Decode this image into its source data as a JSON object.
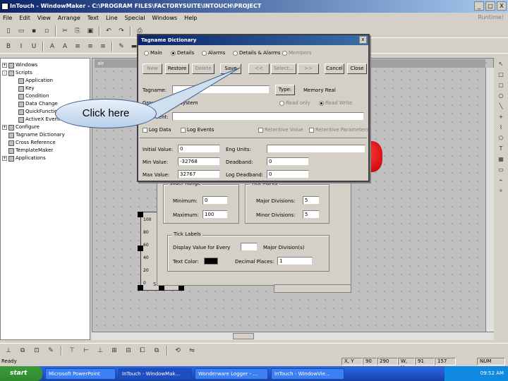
{
  "window": {
    "title": "InTouch - WindowMaker - C:\\PROGRAM FILES\\FACTORYSUITE\\INTOUCH\\PROJECT",
    "runtime_label": "Runtime!",
    "buttons": [
      "_",
      "□",
      "X"
    ]
  },
  "menu": [
    "File",
    "Edit",
    "View",
    "Arrange",
    "Text",
    "Line",
    "Special",
    "Windows",
    "Help"
  ],
  "tree": {
    "items": [
      {
        "label": "Windows",
        "indent": 0,
        "exp": "+"
      },
      {
        "label": "Scripts",
        "indent": 0,
        "exp": "-"
      },
      {
        "label": "Application",
        "indent": 1,
        "exp": ""
      },
      {
        "label": "Key",
        "indent": 1,
        "exp": ""
      },
      {
        "label": "Condition",
        "indent": 1,
        "exp": ""
      },
      {
        "label": "Data Change",
        "indent": 1,
        "exp": ""
      },
      {
        "label": "QuickFunction",
        "indent": 1,
        "exp": ""
      },
      {
        "label": "ActiveX Event",
        "indent": 1,
        "exp": ""
      },
      {
        "label": "Configure",
        "indent": 0,
        "exp": "+"
      },
      {
        "label": "Tagname Dictionary",
        "indent": 0,
        "exp": ""
      },
      {
        "label": "Cross Reference",
        "indent": 0,
        "exp": ""
      },
      {
        "label": "TemplateMaker",
        "indent": 0,
        "exp": ""
      },
      {
        "label": "Applications",
        "indent": 0,
        "exp": "+"
      }
    ]
  },
  "canvas": {
    "title": "air"
  },
  "callout": {
    "text": "Click here"
  },
  "tagname_dialog": {
    "title": "Tagname Dictionary",
    "radios": [
      {
        "label": "Main",
        "on": false,
        "dim": false
      },
      {
        "label": "Details",
        "on": true,
        "dim": false
      },
      {
        "label": "Alarms",
        "on": false,
        "dim": false
      },
      {
        "label": "Details & Alarms",
        "on": false,
        "dim": false
      },
      {
        "label": "Members",
        "on": false,
        "dim": true
      }
    ],
    "buttons": [
      {
        "label": "New",
        "dim": true
      },
      {
        "label": "Restore",
        "dim": false
      },
      {
        "label": "Delete",
        "dim": true
      },
      {
        "label": "Save",
        "dim": false
      },
      {
        "label": "<<",
        "dim": true
      },
      {
        "label": "Select...",
        "dim": true
      },
      {
        "label": ">>",
        "dim": true
      },
      {
        "label": "Cancel",
        "dim": false
      },
      {
        "label": "Close",
        "dim": false
      }
    ],
    "tagname_label": "Tagname:",
    "tagname_value": "",
    "type_button": "Type:",
    "type_value": "Memory Real",
    "group_label": "Group:",
    "group_value": "$System",
    "radio_readonly": "Read only",
    "radio_readwrite": "Read Write",
    "comment_label": "Comment:",
    "log_data": "Log Data",
    "log_events": "Log Events",
    "retentive_value": "Retentive Value",
    "retentive_params": "Retentive Parameters",
    "initial_label": "Initial Value:",
    "initial_value": "0",
    "min_label": "Min Value:",
    "min_value": "-32768",
    "max_label": "Max Value:",
    "max_value": "32767",
    "eng_units_label": "Eng Units:",
    "eng_units_value": "",
    "deadband_label": "Deadband:",
    "deadband_value": "0",
    "logdeadband_label": "Log Deadband:",
    "logdeadband_value": "0"
  },
  "prop_dialog": {
    "slider_range": "Slider Range",
    "minimum_label": "Minimum:",
    "minimum_value": "0",
    "maximum_label": "Maximum:",
    "maximum_value": "100",
    "tick_marks": "Tick Marks",
    "major_div_label": "Major Divisions:",
    "major_div_value": "5",
    "minor_div_label": "Minor Divisions:",
    "minor_div_value": "5",
    "tick_labels": "Tick Labels",
    "display_label": "Display Value for Every",
    "display_value": "",
    "major_division": "Major Division(s)",
    "text_color_label": "Text Color:",
    "decimal_label": "Decimal Places:",
    "decimal_value": "1"
  },
  "slider": {
    "ticks": [
      "100",
      "80",
      "60",
      "40",
      "20",
      "0"
    ],
    "label": "Slider"
  },
  "status": {
    "left": "Ready",
    "cells": [
      "X, Y",
      "90",
      "290",
      "W, H",
      "91",
      "157",
      "NUM"
    ]
  },
  "taskbar": {
    "start": "start",
    "tasks": [
      {
        "label": "Microsoft PowerPoint",
        "active": false
      },
      {
        "label": "InTouch - WindowMak...",
        "active": true
      },
      {
        "label": "Wonderware Logger - ...",
        "active": false
      },
      {
        "label": "InTouch - WindowVie...",
        "active": false
      }
    ],
    "clock": "09:52 AM"
  }
}
